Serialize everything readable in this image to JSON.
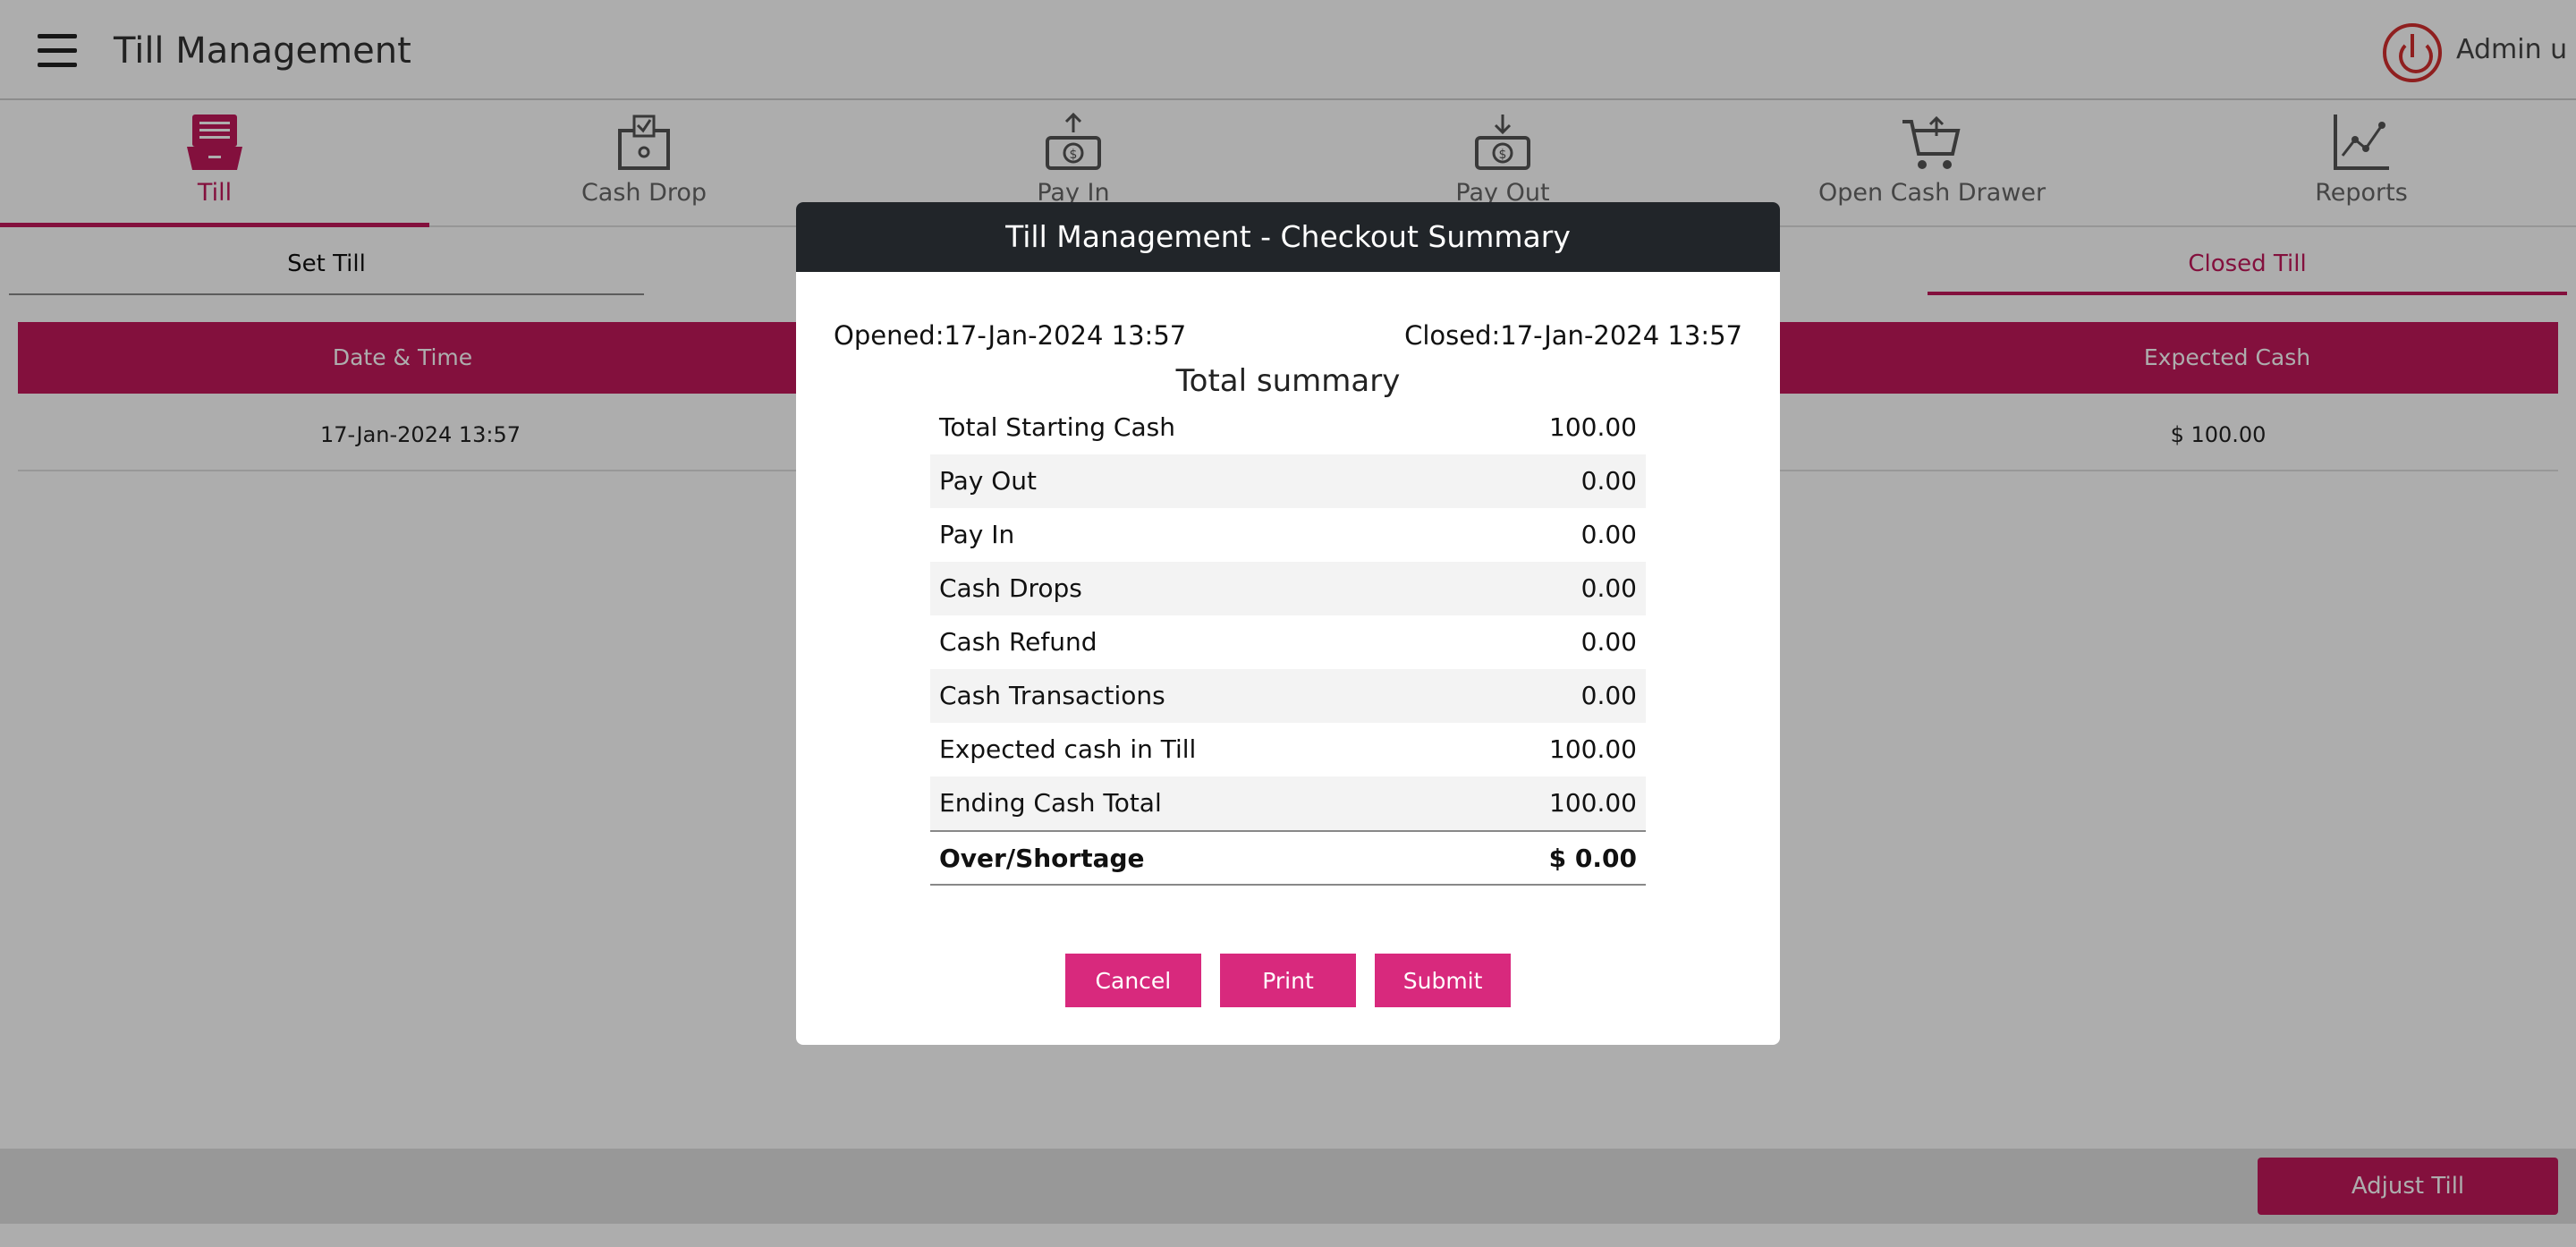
{
  "header": {
    "title": "Till Management",
    "user_name": "Admin u"
  },
  "toolbar": {
    "items": [
      {
        "label": "Till",
        "icon": "till-icon",
        "active": true
      },
      {
        "label": "Cash Drop",
        "icon": "cash-drop-icon"
      },
      {
        "label": "Pay In",
        "icon": "pay-in-icon"
      },
      {
        "label": "Pay Out",
        "icon": "pay-out-icon"
      },
      {
        "label": "Open Cash Drawer",
        "icon": "cart-icon"
      },
      {
        "label": "Reports",
        "icon": "chart-icon"
      }
    ]
  },
  "subtabs": {
    "set_till": "Set Till",
    "closed_till": "Closed Till"
  },
  "table": {
    "headers": {
      "date": "Date & Time",
      "expected": "Expected Cash"
    },
    "rows": [
      {
        "date": "17-Jan-2024 13:57",
        "expected": "$ 100.00"
      }
    ]
  },
  "bottom": {
    "adjust_label": "Adjust Till"
  },
  "modal": {
    "title": "Till Management - Checkout Summary",
    "opened": "Opened:17-Jan-2024 13:57",
    "closed": "Closed:17-Jan-2024 13:57",
    "summary_title": "Total summary",
    "rows": [
      {
        "label": "Total Starting Cash",
        "value": "100.00"
      },
      {
        "label": "Pay Out",
        "value": "0.00"
      },
      {
        "label": "Pay In",
        "value": "0.00"
      },
      {
        "label": "Cash Drops",
        "value": "0.00"
      },
      {
        "label": "Cash Refund",
        "value": "0.00"
      },
      {
        "label": "Cash Transactions",
        "value": "0.00"
      },
      {
        "label": "Expected cash in Till",
        "value": "100.00"
      },
      {
        "label": "Ending Cash Total",
        "value": "100.00"
      }
    ],
    "total": {
      "label": "Over/Shortage",
      "value": "$ 0.00"
    },
    "buttons": {
      "cancel": "Cancel",
      "print": "Print",
      "submit": "Submit"
    }
  },
  "colors": {
    "accent": "#c2185b",
    "modal_header": "#212529",
    "button": "#d8297d",
    "power": "#d32f2f"
  }
}
